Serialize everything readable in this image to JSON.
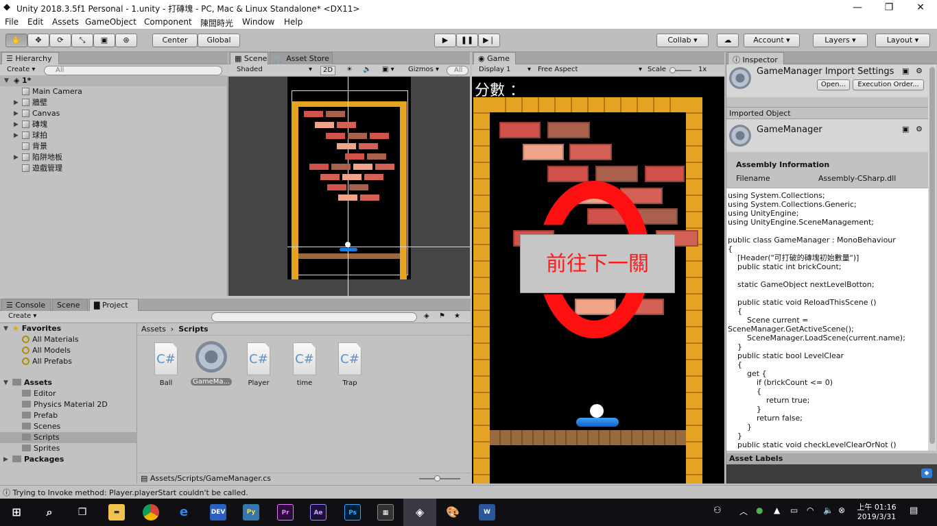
{
  "window": {
    "title": "Unity 2018.3.5f1 Personal - 1.unity - 打磚塊 - PC, Mac & Linux Standalone* <DX11>",
    "min": "—",
    "max": "❐",
    "close": "✕"
  },
  "menu": [
    "File",
    "Edit",
    "Assets",
    "GameObject",
    "Component",
    "陳閭時光",
    "Window",
    "Help"
  ],
  "toolbar": {
    "center": "Center",
    "global": "Global",
    "collab": "Collab",
    "account": "Account",
    "layers": "Layers",
    "layout": "Layout"
  },
  "hierarchy": {
    "tab": "Hierarchy",
    "create": "Create",
    "search_placeholder": "All",
    "scene": "1*",
    "items": [
      "Main Camera",
      "牆壁",
      "Canvas",
      "磚塊",
      "球拍",
      "背景",
      "陷阱地板",
      "遊戲管理"
    ]
  },
  "scene": {
    "tab": "Scene",
    "tab2": "Asset Store",
    "shading": "Shaded",
    "mode2d": "2D",
    "gizmos": "Gizmos",
    "search_placeholder": "All"
  },
  "game": {
    "tab": "Game",
    "display": "Display 1",
    "aspect": "Free Aspect",
    "scale_label": "Scale",
    "scale_value": "1x",
    "score_label": "分數 ：",
    "next_button": "前往下一關"
  },
  "inspector": {
    "tab": "Inspector",
    "title": "GameManager Import Settings",
    "open": "Open...",
    "exec_order": "Execution Order...",
    "imported_label": "Imported Object",
    "object_name": "GameManager",
    "assembly_header": "Assembly Information",
    "filename_label": "Filename",
    "filename_value": "Assembly-CSharp.dll",
    "code": "using System.Collections;\nusing System.Collections.Generic;\nusing UnityEngine;\nusing UnityEngine.SceneManagement;\n\npublic class GameManager : MonoBehaviour\n{\n    [Header(\"可打破的磚塊初始數量\")]\n    public static int brickCount;\n\n    static GameObject nextLevelBotton;\n\n    public static void ReloadThisScene ()\n    {\n        Scene current =\nSceneManager.GetActiveScene();\n        SceneManager.LoadScene(current.name);\n    }\n    public static bool LevelClear\n    {\n        get {\n            if (brickCount <= 0)\n            {\n                return true;\n            }\n            return false;\n        }\n    }\n    public static void checkLevelClearOrNot ()\n    {",
    "asset_labels": "Asset Labels"
  },
  "bottom_tabs": [
    "Console",
    "Scene",
    "Project"
  ],
  "project": {
    "create": "Create",
    "favorites_label": "Favorites",
    "favorites": [
      "All Materials",
      "All Models",
      "All Prefabs"
    ],
    "assets_label": "Assets",
    "folders": [
      "Editor",
      "Physics Material 2D",
      "Prefab",
      "Scenes",
      "Scripts",
      "Sprites"
    ],
    "packages_label": "Packages",
    "breadcrumb_root": "Assets",
    "breadcrumb_current": "Scripts",
    "files": [
      {
        "name": "Ball",
        "type": "cs"
      },
      {
        "name": "GameMa...",
        "type": "gear"
      },
      {
        "name": "Player",
        "type": "cs"
      },
      {
        "name": "time",
        "type": "cs"
      },
      {
        "name": "Trap",
        "type": "cs"
      }
    ],
    "path": "Assets/Scripts/GameManager.cs"
  },
  "status": "Trying to Invoke method: Player.playerStart couldn't be called.",
  "clock": {
    "time": "上午 01:16",
    "date": "2019/3/31"
  },
  "taskbar_apps": [
    "DEV",
    "Pr",
    "Ae",
    "Ps"
  ],
  "colors": {
    "accent_red": "#ff1010",
    "paddle": "#1e7fe0",
    "frame": "#e5a324",
    "floor": "#9a6a3f"
  }
}
